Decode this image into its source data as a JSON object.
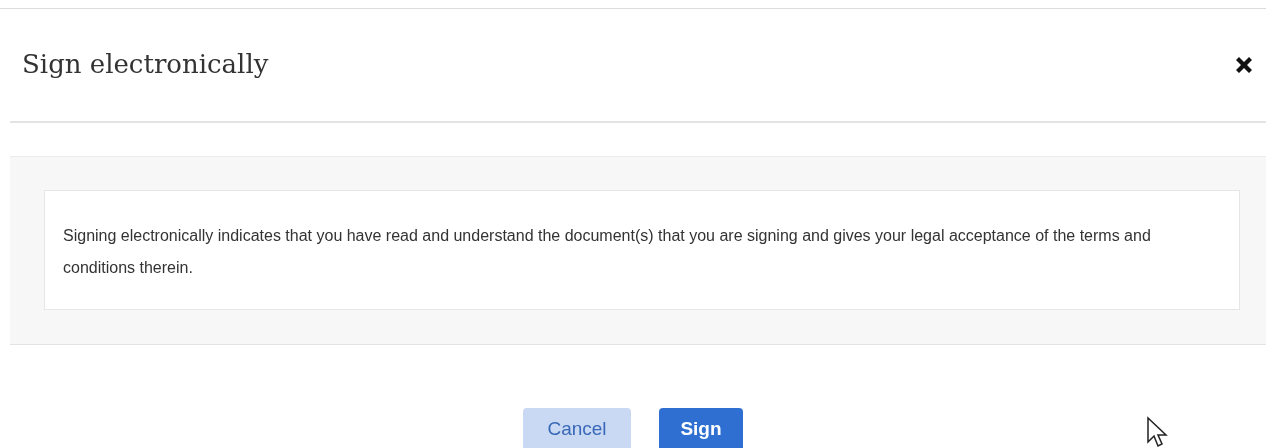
{
  "dialog": {
    "title": "Sign electronically",
    "message": "Signing electronically indicates that you have read and understand the document(s) that you are signing and gives your legal acceptance of the terms and conditions therein.",
    "buttons": [
      {
        "label": "Cancel",
        "kind": "secondary"
      },
      {
        "label": "Sign",
        "kind": "primary"
      }
    ]
  }
}
